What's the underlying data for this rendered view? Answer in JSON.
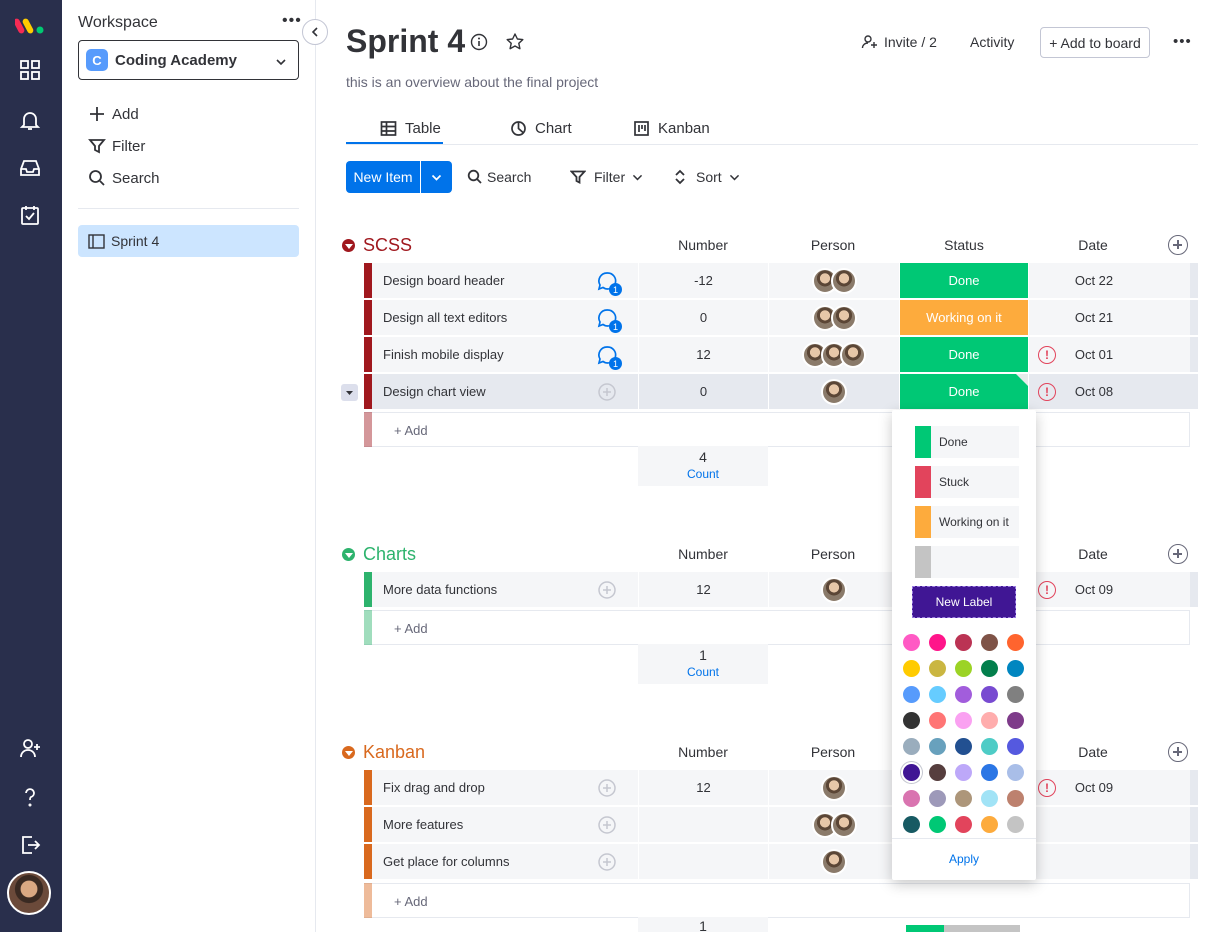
{
  "sidebar": {
    "workspace_label": "Workspace",
    "workspace_initial": "C",
    "workspace_name": "Coding Academy",
    "add_label": "Add",
    "filter_label": "Filter",
    "search_label": "Search",
    "board_item": "Sprint 4"
  },
  "header": {
    "title": "Sprint 4",
    "description": "this is an overview about the final project",
    "invite_label": "Invite / 2",
    "activity_label": "Activity",
    "add_to_board_label": "+ Add to board"
  },
  "tabs": [
    {
      "label": "Table",
      "icon": "table-icon"
    },
    {
      "label": "Chart",
      "icon": "chart-icon"
    },
    {
      "label": "Kanban",
      "icon": "kanban-icon"
    }
  ],
  "toolbar": {
    "new_item_label": "New Item",
    "search_label": "Search",
    "filter_label": "Filter",
    "sort_label": "Sort"
  },
  "columns": {
    "number": "Number",
    "person": "Person",
    "status": "Status",
    "date": "Date"
  },
  "colors": {
    "done": "#00c875",
    "working": "#fdab3d",
    "stuck": "#e2445c",
    "scss": "#a0181e",
    "charts": "#2db36d",
    "kanban": "#d9691e",
    "accent": "#0073ea",
    "rail": "#292f4c"
  },
  "groups": [
    {
      "title": "SCSS",
      "add_label": "+ Add",
      "count": "4",
      "count_label": "Count",
      "rows": [
        {
          "name": "Design board header",
          "number": "-12",
          "status": "Done",
          "date": "Oct 22",
          "updates": "1"
        },
        {
          "name": "Design all text editors",
          "number": "0",
          "status": "Working on it",
          "date": "Oct 21",
          "updates": "1"
        },
        {
          "name": "Finish mobile display",
          "number": "12",
          "status": "Done",
          "date": "Oct 01",
          "updates": "1"
        },
        {
          "name": "Design chart view",
          "number": "0",
          "status": "Done",
          "date": "Oct 08",
          "updates": ""
        }
      ]
    },
    {
      "title": "Charts",
      "add_label": "+ Add",
      "count": "1",
      "count_label": "Count",
      "rows": [
        {
          "name": "More data functions",
          "number": "12",
          "status": "",
          "date": "Oct 09"
        }
      ]
    },
    {
      "title": "Kanban",
      "add_label": "+ Add",
      "count": "1",
      "rows": [
        {
          "name": "Fix drag and drop",
          "number": "12",
          "status": "",
          "date": "Oct 09"
        },
        {
          "name": "More features",
          "number": "",
          "status": "",
          "date": ""
        },
        {
          "name": "Get place for columns",
          "number": "",
          "status": "",
          "date": ""
        }
      ]
    }
  ],
  "status_popup": {
    "labels": [
      {
        "text": "Done",
        "color": "#00c875"
      },
      {
        "text": "Stuck",
        "color": "#e2445c"
      },
      {
        "text": "Working on it",
        "color": "#fdab3d"
      },
      {
        "text": "",
        "color": "#c4c4c4"
      }
    ],
    "new_label": "New Label",
    "apply_label": "Apply",
    "palette": [
      "#ff5ac4",
      "#ff158a",
      "#bb3354",
      "#7f5347",
      "#ff642e",
      "#ffcb00",
      "#cab641",
      "#9cd326",
      "#037f4c",
      "#0086c0",
      "#579bfc",
      "#66ccff",
      "#a25ddc",
      "#784bd1",
      "#808080",
      "#333333",
      "#ff7575",
      "#faa1f1",
      "#ffadad",
      "#7e3b8a",
      "#9aadbd",
      "#68a1bd",
      "#225091",
      "#4eccc6",
      "#5559df",
      "#401694",
      "#563e3e",
      "#bda8f9",
      "#2b76e5",
      "#a9bee8",
      "#d974b0",
      "#9d99b9",
      "#ad967a",
      "#a1e3f6",
      "#bd816e",
      "#175a63",
      "#00c875",
      "#e2445c",
      "#fdab3d",
      "#c4c4c4"
    ]
  }
}
